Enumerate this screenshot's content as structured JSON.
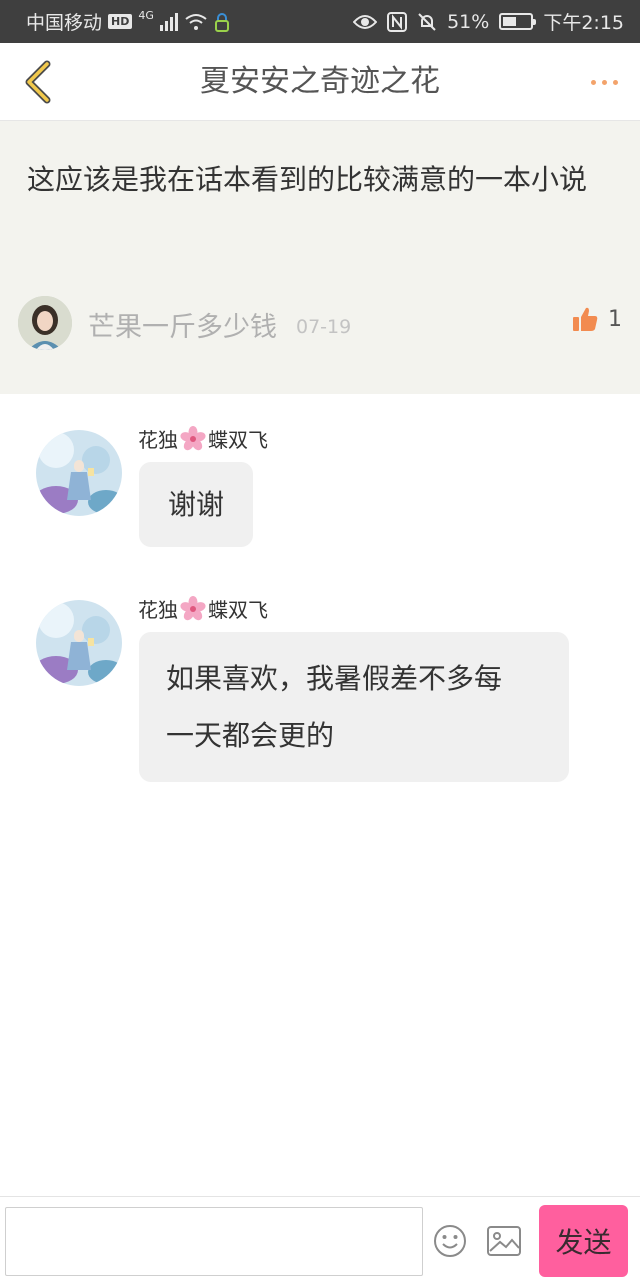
{
  "status_bar": {
    "carrier": "中国移动",
    "hd_badge": "HD",
    "network": "4G",
    "battery_percent": "51%",
    "battery_level": 0.51,
    "time": "下午2:15"
  },
  "header": {
    "title": "夏安安之奇迹之花",
    "back_icon": "chevron-left-icon",
    "more_icon": "more-dots-icon",
    "accent_color": "#f3a36b"
  },
  "post": {
    "text": "这应该是我在话本看到的比较满意的一本小说",
    "author": "芒果一斤多少钱",
    "date": "07-19",
    "likes": "1",
    "like_icon": "thumbs-up-icon"
  },
  "replies": [
    {
      "name_part1": "花独",
      "name_icon": "sakura-flower-icon",
      "name_part2": "蝶双飞",
      "text": "谢谢"
    },
    {
      "name_part1": "花独",
      "name_icon": "sakura-flower-icon",
      "name_part2": "蝶双飞",
      "text": "如果喜欢，我暑假差不多每一天都会更的"
    }
  ],
  "input_bar": {
    "placeholder": "",
    "emoji_icon": "smiley-icon",
    "image_icon": "image-icon",
    "send_label": "发送",
    "send_color": "#ff5f9e"
  }
}
